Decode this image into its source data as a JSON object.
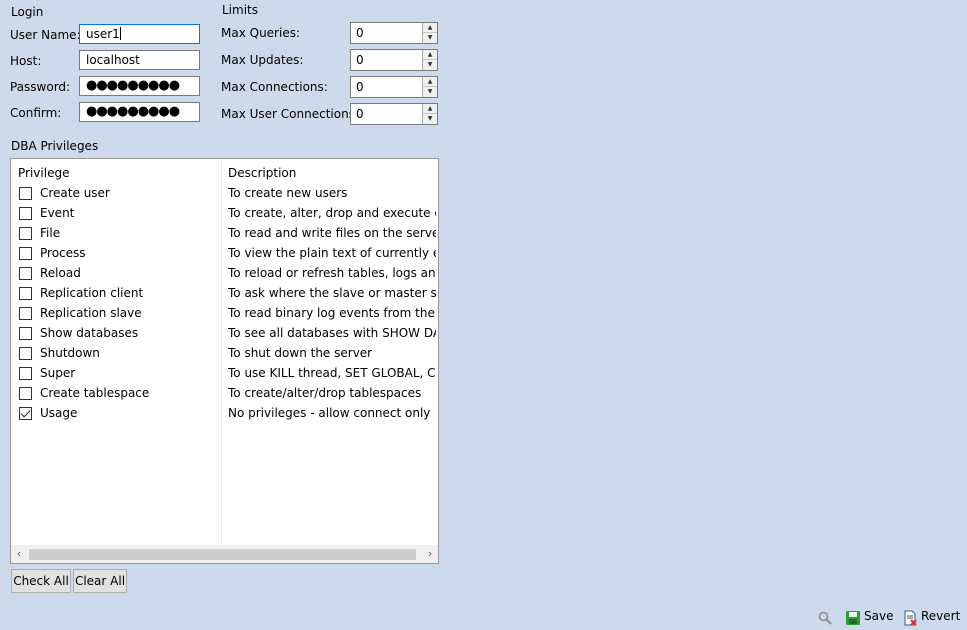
{
  "login": {
    "title": "Login",
    "user_name_label": "User Name:",
    "user_name_value": "user1",
    "host_label": "Host:",
    "host_value": "localhost",
    "password_label": "Password:",
    "password_value": "●●●●●●●●●",
    "confirm_label": "Confirm:",
    "confirm_value": "●●●●●●●●●"
  },
  "limits": {
    "title": "Limits",
    "max_queries_label": "Max Queries:",
    "max_queries_value": "0",
    "max_updates_label": "Max Updates:",
    "max_updates_value": "0",
    "max_connections_label": "Max Connections:",
    "max_connections_value": "0",
    "max_user_connections_label": "Max User Connections:",
    "max_user_connections_value": "0"
  },
  "dba": {
    "title": "DBA Privileges",
    "col_privilege": "Privilege",
    "col_description": "Description",
    "rows": [
      {
        "privilege": "Create user",
        "description": "To create new users",
        "checked": false
      },
      {
        "privilege": "Event",
        "description": "To create, alter, drop and execute eve...",
        "checked": false
      },
      {
        "privilege": "File",
        "description": "To read and write files on the server",
        "checked": false
      },
      {
        "privilege": "Process",
        "description": "To view the plain text of currently exe...",
        "checked": false
      },
      {
        "privilege": "Reload",
        "description": "To reload or refresh tables, logs and ...",
        "checked": false
      },
      {
        "privilege": "Replication client",
        "description": "To ask where the slave or master serv...",
        "checked": false
      },
      {
        "privilege": "Replication slave",
        "description": "To read binary log events from the m...",
        "checked": false
      },
      {
        "privilege": "Show databases",
        "description": "To see all databases with SHOW DAT...",
        "checked": false
      },
      {
        "privilege": "Shutdown",
        "description": "To shut down the server",
        "checked": false
      },
      {
        "privilege": "Super",
        "description": "To use KILL thread, SET GLOBAL, CH...",
        "checked": false
      },
      {
        "privilege": "Create tablespace",
        "description": "To create/alter/drop tablespaces",
        "checked": false
      },
      {
        "privilege": "Usage",
        "description": "No privileges - allow connect only",
        "checked": true
      }
    ],
    "check_all_label": "Check All",
    "clear_all_label": "Clear All"
  },
  "toolbar": {
    "search_icon": "magnifier-icon",
    "save_label": "Save",
    "save_icon": "floppy-disk-icon",
    "revert_label": "Revert",
    "revert_icon": "document-x-icon"
  },
  "colors": {
    "background": "#ccdaeb",
    "focus_border": "#0078d7",
    "save_icon_green": "#2e9b3a",
    "revert_icon_red": "#d03030"
  }
}
